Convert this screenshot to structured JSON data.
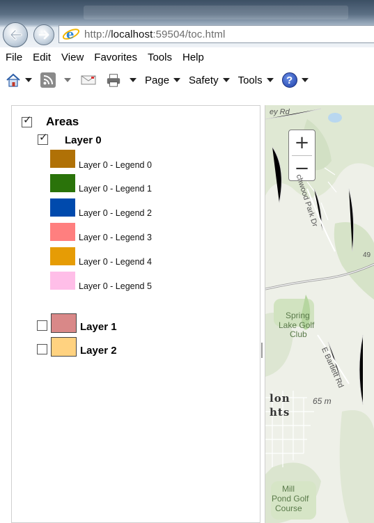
{
  "browser": {
    "url_prefix": "http://",
    "url_host": "localhost",
    "url_rest": ":59504/toc.html",
    "menu": [
      "File",
      "Edit",
      "View",
      "Favorites",
      "Tools",
      "Help"
    ],
    "commands": [
      "Page",
      "Safety",
      "Tools"
    ]
  },
  "toc": {
    "group_label": "Areas",
    "layer0_label": "Layer 0",
    "legend": [
      {
        "label": "Layer 0 - Legend 0",
        "color": "#b07106"
      },
      {
        "label": "Layer 0 - Legend 1",
        "color": "#2a730a"
      },
      {
        "label": "Layer 0 - Legend 2",
        "color": "#004aad"
      },
      {
        "label": "Layer 0 - Legend 3",
        "color": "#ff7f7f"
      },
      {
        "label": "Layer 0 - Legend 4",
        "color": "#e69c05"
      },
      {
        "label": "Layer 0 - Legend 5",
        "color": "#ffbee8"
      }
    ],
    "layer1_label": "Layer 1",
    "layer1_color": "#d98888",
    "layer2_label": "Layer 2",
    "layer2_color": "#ffd280"
  },
  "map": {
    "zoom_in": "+",
    "zoom_out": "−",
    "labels": {
      "road_top": "ey Rd",
      "road_park": "chwood Park Dr",
      "num_49": "49",
      "golf1_line1": "Spring",
      "golf1_line2": "Lake Golf",
      "golf1_line3": "Club",
      "road_bartlett": "E Bartlett Rd",
      "elev": "65 m",
      "town1": "lon",
      "town2": "hts",
      "golf2_line1": "Mill",
      "golf2_line2": "Pond Golf",
      "golf2_line3": "Course"
    }
  }
}
